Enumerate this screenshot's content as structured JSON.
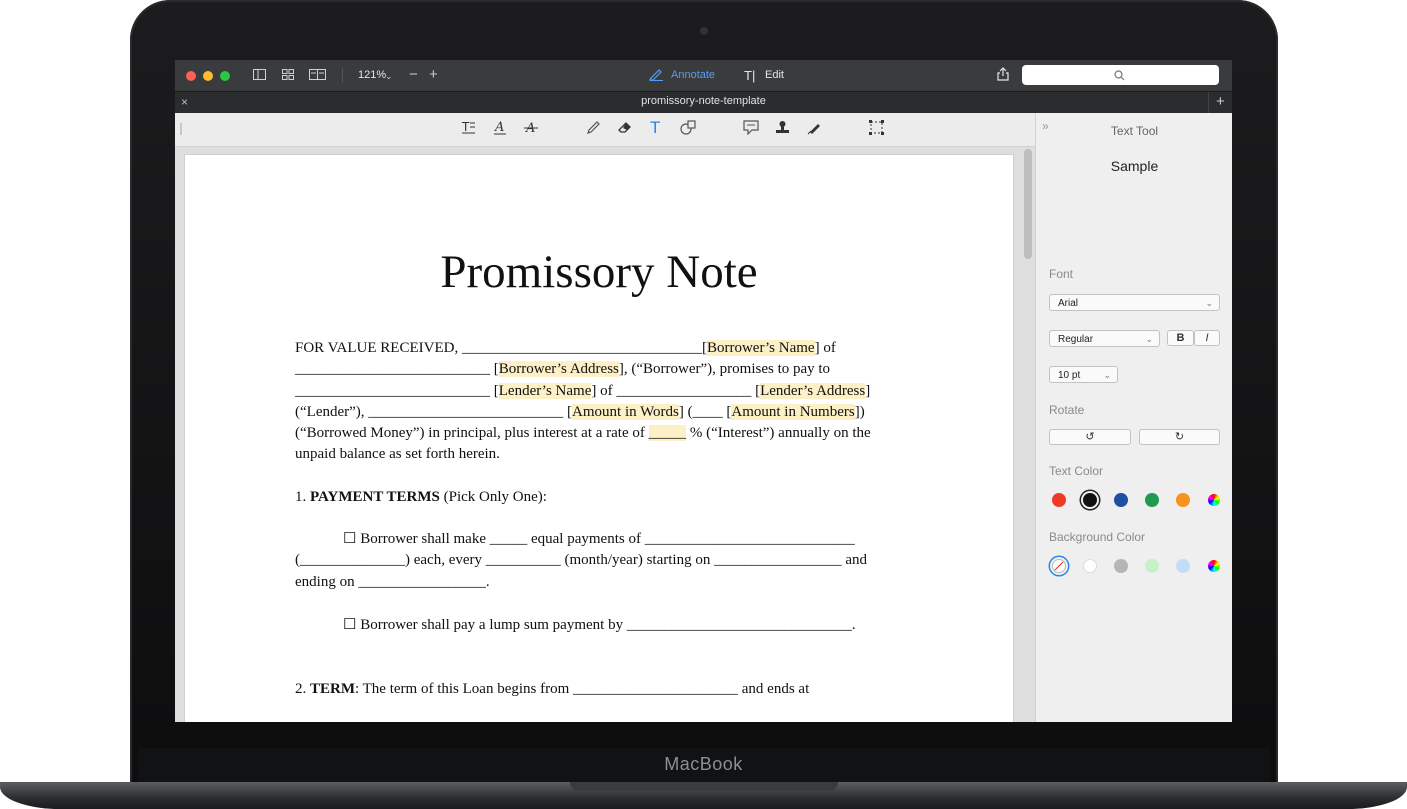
{
  "device": {
    "brand": "MacBook"
  },
  "window": {
    "zoom": "121%",
    "mode_tabs": [
      {
        "label": "Annotate",
        "active": true
      },
      {
        "label": "Edit",
        "active": false
      }
    ],
    "search_placeholder": "",
    "tab_title": "promissory-note-template"
  },
  "toolbar": {
    "tools": [
      "text-box-icon",
      "text-underline-icon",
      "text-strikethrough-icon",
      "pencil-icon",
      "eraser-icon",
      "text-tool-icon",
      "shapes-icon",
      "note-icon",
      "stamp-icon",
      "signature-icon",
      "selection-icon"
    ]
  },
  "document": {
    "title": "Promissory Note",
    "paragraph1": {
      "l1_a": "FOR VALUE RECEIVED, ________________________________",
      "l1_hl": "Borrower’s Name",
      "l1_b": "] of",
      "l2_a": "__________________________ [",
      "l2_hl": "Borrower’s Address",
      "l2_b": "], (“Borrower”), promises to pay to",
      "l3_a": "__________________________ [",
      "l3_hl1": "Lender’s Name",
      "l3_b": "] of __________________ [",
      "l3_hl2": "Lender’s Address",
      "l3_c": "]",
      "l4_a": "(“Lender”), __________________________ [",
      "l4_hl1": "Amount in Words",
      "l4_b": "] (____ [",
      "l4_hl2": "Amount in Numbers",
      "l4_c": "])",
      "l5_a": "(“Borrowed Money”) in principal, plus interest at a rate of ",
      "l5_hl": "_____",
      "l5_b": " % (“Interest”) annually on the",
      "l6": "unpaid balance as set forth herein."
    },
    "section1": {
      "number": "1. ",
      "heading": "PAYMENT TERMS",
      "note": " (Pick Only One):"
    },
    "option1": {
      "l1": "☐ Borrower shall make _____ equal payments of ____________________________",
      "l2": "(______________) each, every __________ (month/year) starting on _________________ and",
      "l3": "ending on _________________."
    },
    "option2": {
      "l1": "☐ Borrower shall pay a lump sum payment by ______________________________."
    },
    "section2": {
      "number": "2. ",
      "heading": "TERM",
      "text": ": The term of this Loan begins from ______________________ and ends at"
    }
  },
  "panel": {
    "title": "Text Tool",
    "sample": "Sample",
    "font_label": "Font",
    "font_value": "Arial",
    "style_value": "Regular",
    "bold_label": "B",
    "italic_label": "I",
    "size_value": "10 pt",
    "rotate_label": "Rotate",
    "text_color_label": "Text Color",
    "text_colors": [
      "#ee3a24",
      "#111111",
      "#1e4fa3",
      "#1f9a4e",
      "#f7931e",
      "spectrum"
    ],
    "text_color_selected": "#111111",
    "bg_color_label": "Background Color",
    "bg_colors": [
      "none",
      "#ffffff",
      "#b5b5b5",
      "#c6f0c9",
      "#c4dcf7",
      "spectrum"
    ],
    "bg_color_selected": "none"
  }
}
